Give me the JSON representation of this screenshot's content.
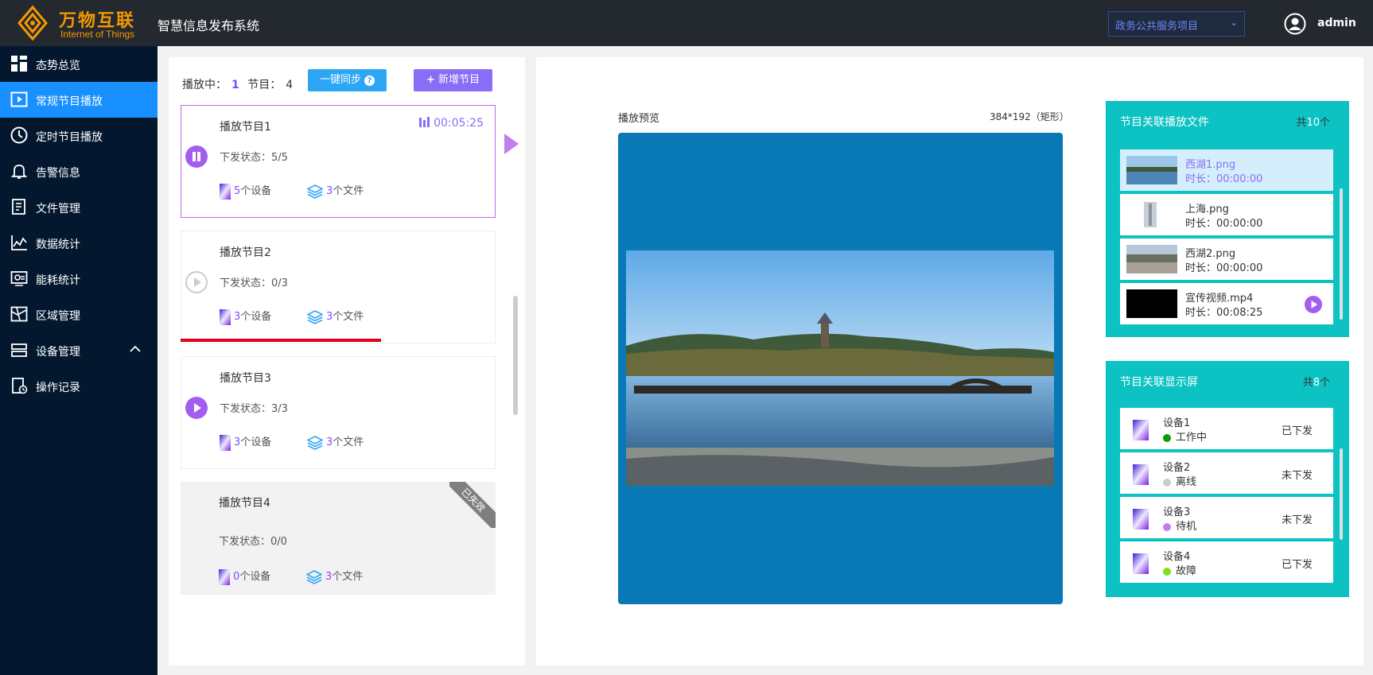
{
  "header": {
    "brand_cn": "万物互联",
    "brand_en": "Internet of Things",
    "system_title": "智慧信息发布系统",
    "project_selected": "政务公共服务项目",
    "user_name": "admin"
  },
  "sidebar": {
    "items": [
      {
        "label": "态势总览",
        "icon": "dashboard-icon"
      },
      {
        "label": "常规节目播放",
        "icon": "play-screen-icon",
        "active": true
      },
      {
        "label": "定时节目播放",
        "icon": "clock-icon"
      },
      {
        "label": "告警信息",
        "icon": "bell-icon"
      },
      {
        "label": "文件管理",
        "icon": "file-icon"
      },
      {
        "label": "数据统计",
        "icon": "chart-icon"
      },
      {
        "label": "能耗统计",
        "icon": "energy-icon"
      },
      {
        "label": "区域管理",
        "icon": "map-icon"
      },
      {
        "label": "设备管理",
        "icon": "device-icon",
        "expandable": true
      },
      {
        "label": "操作记录",
        "icon": "record-icon"
      }
    ]
  },
  "program_list": {
    "playing_label": "播放中：",
    "playing_count": "1",
    "program_label": "节目：",
    "program_count": "4",
    "sync_button": "一键同步",
    "add_button": "新增节目",
    "programs": [
      {
        "title": "播放节目1",
        "status": "下发状态：5/5",
        "device_count": "5",
        "device_suffix": "个设备",
        "file_count": "3",
        "file_suffix": "个文件",
        "time": "00:05:25"
      },
      {
        "title": "播放节目2",
        "status": "下发状态：0/3",
        "device_count": "3",
        "device_suffix": "个设备",
        "file_count": "3",
        "file_suffix": "个文件"
      },
      {
        "title": "播放节目3",
        "status": "下发状态：3/3",
        "device_count": "3",
        "device_suffix": "个设备",
        "file_count": "3",
        "file_suffix": "个文件"
      },
      {
        "title": "播放节目4",
        "status": "下发状态：0/0",
        "device_count": "0",
        "device_suffix": "个设备",
        "file_count": "3",
        "file_suffix": "个文件",
        "ribbon": "已失效"
      }
    ]
  },
  "preview": {
    "label": "播放预览",
    "size": "384*192（矩形）"
  },
  "files_panel": {
    "title": "节目关联播放文件",
    "count_prefix": "共",
    "count": "10",
    "count_suffix": "个",
    "files": [
      {
        "name": "西湖1.png",
        "duration": "时长：00:00:00"
      },
      {
        "name": "上海.png",
        "duration": "时长：00:00:00"
      },
      {
        "name": "西湖2.png",
        "duration": "时长：00:00:00"
      },
      {
        "name": "宣传视频.mp4",
        "duration": "时长：00:08:25"
      }
    ]
  },
  "devices_panel": {
    "title": "节目关联显示屏",
    "count_prefix": "共",
    "count": "8",
    "count_suffix": "个",
    "devices": [
      {
        "name": "设备1",
        "state": "工作中",
        "state_color": "#0a9a0a",
        "issued": "已下发"
      },
      {
        "name": "设备2",
        "state": "离线",
        "state_color": "#cccccc",
        "issued": "未下发"
      },
      {
        "name": "设备3",
        "state": "待机",
        "state_color": "#c07ef0",
        "issued": "未下发"
      },
      {
        "name": "设备4",
        "state": "故障",
        "state_color": "#7fe01a",
        "issued": "已下发"
      }
    ]
  }
}
